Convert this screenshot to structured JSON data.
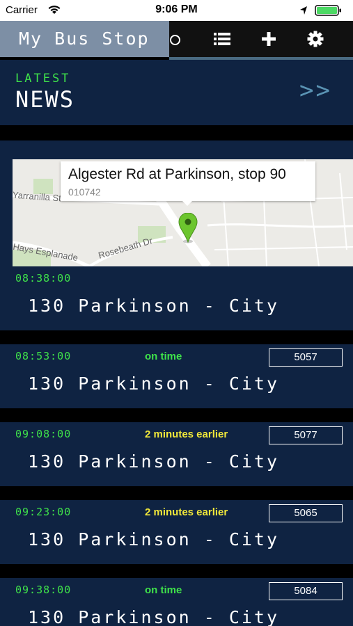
{
  "status_bar": {
    "carrier": "Carrier",
    "time": "9:06 PM"
  },
  "nav": {
    "title": "My Bus Stop"
  },
  "news": {
    "top": "LATEST",
    "main": "NEWS",
    "arrow": ">>"
  },
  "stop": {
    "name": "Algester Rd at Parkinson, stop 90",
    "id": "010742",
    "streets": [
      "Yarranilla St",
      "Rosebeath Dr",
      "Hays Esplanade"
    ]
  },
  "departures": [
    {
      "time": "08:38:00",
      "status": "",
      "status_color": "",
      "bus": "",
      "route": "130 Parkinson - City"
    },
    {
      "time": "08:53:00",
      "status": "on time",
      "status_color": "#3fe24a",
      "bus": "5057",
      "route": "130 Parkinson - City"
    },
    {
      "time": "09:08:00",
      "status": "2 minutes earlier",
      "status_color": "#f1e83a",
      "bus": "5077",
      "route": "130 Parkinson - City"
    },
    {
      "time": "09:23:00",
      "status": "2 minutes earlier",
      "status_color": "#f1e83a",
      "bus": "5065",
      "route": "130 Parkinson - City"
    },
    {
      "time": "09:38:00",
      "status": "on time",
      "status_color": "#3fe24a",
      "bus": "5084",
      "route": "130 Parkinson - City"
    }
  ],
  "colors": {
    "accent_green": "#3fe24a",
    "warning_yellow": "#f1e83a",
    "panel": "#0f2342",
    "title_bg": "#7d8fa5"
  },
  "icons": [
    "wifi-icon",
    "location-arrow-icon",
    "battery-icon",
    "list-icon",
    "plus-icon",
    "gear-icon",
    "map-pin-icon"
  ]
}
